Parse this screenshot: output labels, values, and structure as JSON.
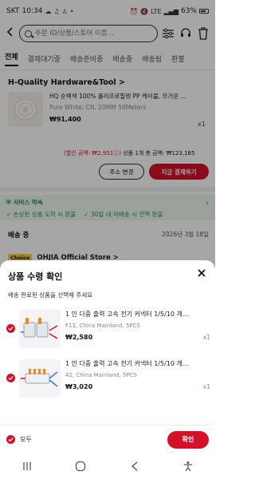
{
  "status_bar": {
    "carrier": "SKT",
    "time": "10:34",
    "network": "LTE",
    "battery": "63%"
  },
  "search": {
    "placeholder": "주문 ID/상품/스토어 이름..."
  },
  "tabs": [
    {
      "label": "전체",
      "active": true
    },
    {
      "label": "결제대기중"
    },
    {
      "label": "배송준비중"
    },
    {
      "label": "배송중"
    },
    {
      "label": "배송됨"
    },
    {
      "label": "환불"
    }
  ],
  "order1": {
    "store": "H-Quality Hardware&Tool >",
    "item_name": "HQ 순백색 100% 폴리프로필렌 PP 케이블, 무거운 ...",
    "item_spec": "Pure White, CN, 20MM 50Meters",
    "item_price": "₩91,400",
    "item_qty": "x1",
    "discount_label": "(할인 금액: ₩2,951ⓘ)",
    "total_label": "상품 1개 총 금액: ₩123,185",
    "btn_address": "주소 변경",
    "btn_pay": "지금 결제하기"
  },
  "service": {
    "title": "서비스 약속",
    "left": "손상된 상품 도착 시 환불",
    "right": "30일 내 미배송 시 전액 환불"
  },
  "order2": {
    "status": "배송 중",
    "date": "2026년 3월 18일",
    "choice": "Choice",
    "store": "OHJIA Official Store >"
  },
  "sheet": {
    "title": "상품 수령 확인",
    "subtitle": "배송 완료된 상품을 선택해 주세요",
    "items": [
      {
        "name": "1 인 다중 출력 고속 전기 커넥터 1/5/10 개...",
        "spec": "F13, China Mainland, 5PCS",
        "price": "₩2,580",
        "qty": "x1"
      },
      {
        "name": "1 인 다중 출력 고속 전기 커넥터 1/5/10 개...",
        "spec": "42, China Mainland, 5PCS",
        "price": "₩3,020",
        "qty": "x1"
      }
    ],
    "select_all": "모두",
    "confirm": "확인"
  },
  "colors": {
    "accent": "#d4112a",
    "service_green": "#1b8a3a"
  }
}
